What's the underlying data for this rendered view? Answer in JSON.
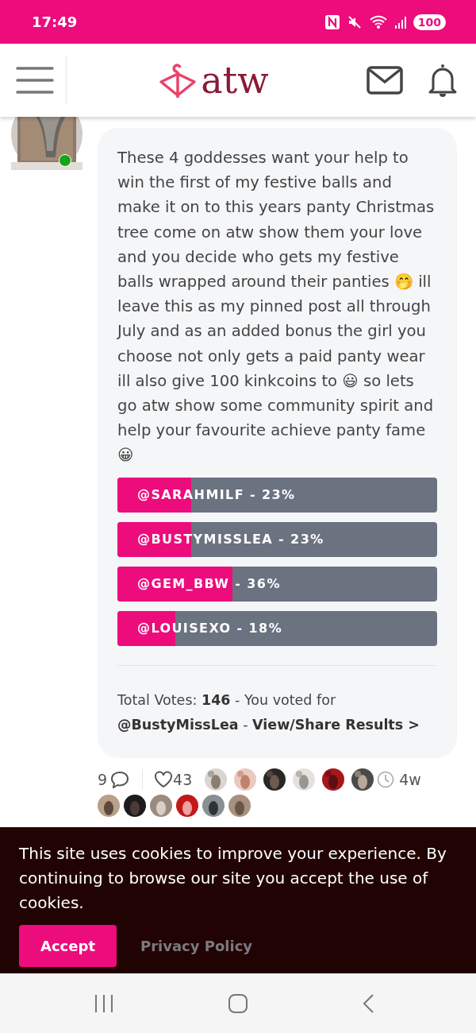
{
  "status_bar": {
    "time": "17:49",
    "battery": "100"
  },
  "header": {
    "logo_text": "atw"
  },
  "post": {
    "text": "These 4 goddesses want your help to win the first of my festive balls and make it on to this years panty Christmas tree come on atw show them your love and you decide who gets my festive balls wrapped around their panties 🤭 ill leave this as my pinned post all through July and as an added bonus the girl you choose not only gets a paid panty wear ill also give 100 kinkcoins to 😃 so lets go atw show some community spirit and help your favourite achieve panty fame 😀",
    "poll": [
      {
        "label": "@SARAHMILF - 23%",
        "level": 0.23
      },
      {
        "label": "@BUSTYMISSLEA - 23%",
        "level": 0.23
      },
      {
        "label": "@GEM_BBW - 36%",
        "level": 0.36
      },
      {
        "label": "@LOUISEXO - 18%",
        "level": 0.18
      }
    ],
    "summary": "Total Votes: **146** - You voted for **@BustyMissLea** -",
    "results_link": "View/Share Results >"
  },
  "stats": {
    "comments": "9",
    "likes": "43",
    "age": "4w"
  },
  "cookie_banner": {
    "text": "This site uses cookies to improve your experience. By continuing to browse our site you accept the use of cookies.",
    "accept": "Accept",
    "policy": "Privacy Policy"
  }
}
